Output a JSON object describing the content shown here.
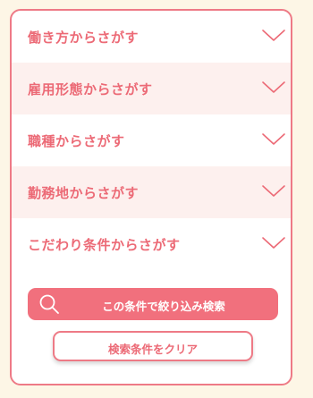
{
  "filters": [
    {
      "label": "働き方からさがす"
    },
    {
      "label": "雇用形態からさがす"
    },
    {
      "label": "職種からさがす"
    },
    {
      "label": "勤務地からさがす"
    },
    {
      "label": "こだわり条件からさがす"
    }
  ],
  "actions": {
    "search_label": "この条件で絞り込み検索",
    "clear_label": "検索条件をクリア"
  },
  "icons": {
    "expand": "chevron-down-icon",
    "search": "magnifier-icon"
  },
  "colors": {
    "accent": "#ec6a76",
    "alt_row": "#fdf0ee",
    "page_background": "#fdf6e6"
  }
}
